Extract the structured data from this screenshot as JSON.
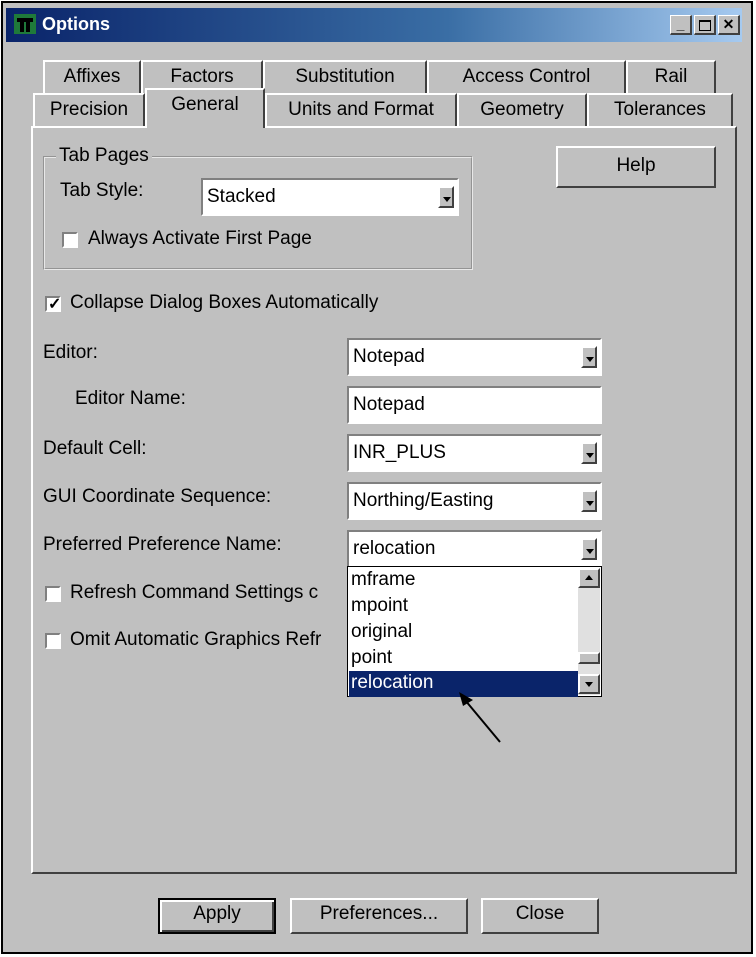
{
  "window": {
    "title": "Options",
    "controls": [
      "minimize",
      "maximize",
      "close"
    ]
  },
  "tabs": {
    "row1": [
      "Affixes",
      "Factors",
      "Substitution",
      "Access Control",
      "Rail"
    ],
    "row2": [
      "Precision",
      "General",
      "Units and Format",
      "Geometry",
      "Tolerances"
    ],
    "active": "General"
  },
  "tab_pages": {
    "group_label": "Tab Pages",
    "tab_style_label": "Tab Style:",
    "tab_style_value": "Stacked",
    "always_activate_label": "Always Activate First Page",
    "always_activate_checked": false
  },
  "help_label": "Help",
  "collapse": {
    "label": "Collapse Dialog Boxes Automatically",
    "checked": true
  },
  "editor": {
    "label": "Editor:",
    "value": "Notepad"
  },
  "editor_name": {
    "label": "Editor Name:",
    "value": "Notepad"
  },
  "default_cell": {
    "label": "Default Cell:",
    "value": "INR_PLUS"
  },
  "gui_coord": {
    "label": "GUI Coordinate Sequence:",
    "value": "Northing/Easting"
  },
  "preferred_pref": {
    "label": "Preferred Preference Name:",
    "value": "relocation",
    "options": [
      "mframe",
      "mpoint",
      "original",
      "point",
      "relocation"
    ],
    "selected": "relocation"
  },
  "refresh": {
    "label": "Refresh Command Settings c",
    "checked": false
  },
  "omit": {
    "label": "Omit Automatic Graphics Refr",
    "checked": false
  },
  "footer": {
    "apply": "Apply",
    "preferences": "Preferences...",
    "close": "Close"
  },
  "colors": {
    "face": "#c0c0c0",
    "title_start": "#0a246a",
    "selection": "#0a246a"
  }
}
